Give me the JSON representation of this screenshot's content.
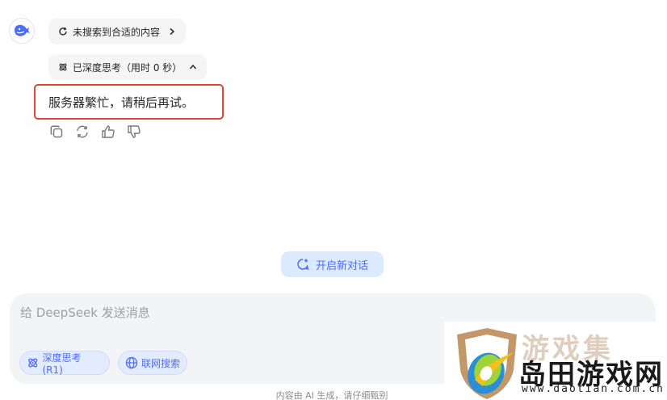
{
  "message": {
    "search_status": "未搜索到合适的内容",
    "thinking_status": "已深度思考（用时 0 秒）",
    "answer": "服务器繁忙，请稍后再试。"
  },
  "new_chat_label": "开启新对话",
  "composer": {
    "placeholder": "给 DeepSeek 发送消息",
    "deep_think_label": "深度思考 (R1)",
    "web_search_label": "联网搜索"
  },
  "footer_text": "内容由 AI 生成，请仔细甄别",
  "watermark": {
    "faded_text": "游戏集",
    "site_name": "岛田游戏网",
    "site_url": "www.daotian.com.cn"
  },
  "colors": {
    "accent": "#4d6bfe",
    "highlight_border": "#e0452f",
    "chip_bg": "#e3ebfe",
    "pill_bg": "#f5f5f5"
  },
  "icons": {
    "avatar": "deepseek-whale-icon",
    "search": "refresh-search-icon",
    "thinking": "atom-icon",
    "copy": "copy-icon",
    "regenerate": "regenerate-icon",
    "like": "thumbs-up-icon",
    "dislike": "thumbs-down-icon"
  }
}
